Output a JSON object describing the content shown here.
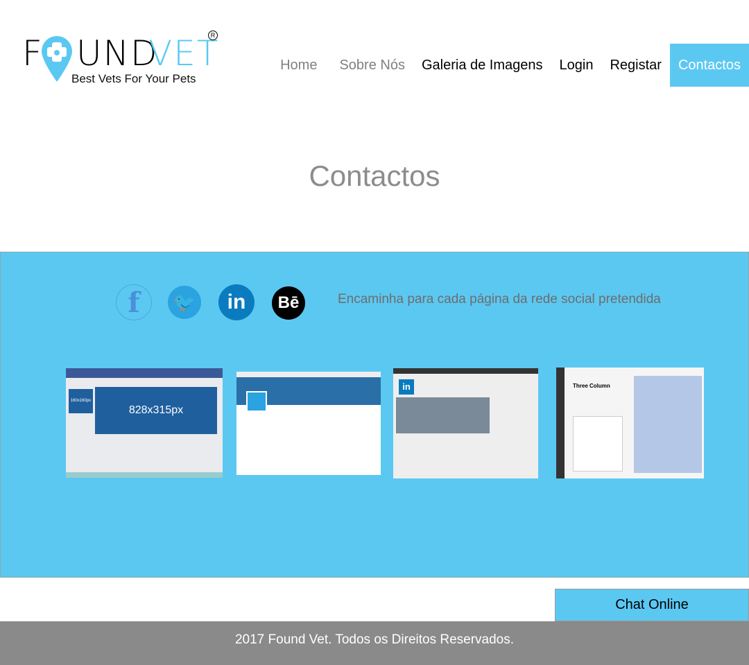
{
  "logo": {
    "found": "F",
    "und": "UND",
    "vet": "VET",
    "tagline": "Best Vets For Your Pets",
    "registered": "R"
  },
  "nav": [
    {
      "label": "Home"
    },
    {
      "label": "Sobre Nós"
    },
    {
      "label": "Galeria de Imagens"
    },
    {
      "label": "Login"
    },
    {
      "label": "Registar"
    },
    {
      "label": "Contactos"
    }
  ],
  "page_title": "Contactos",
  "social": {
    "message": "Encaminha para cada página da rede social pretendida",
    "icons": [
      "facebook-icon",
      "twitter-icon",
      "linkedin-icon",
      "behance-icon"
    ],
    "facebook_cover": "828x315px",
    "facebook_avatar": "160x160px",
    "behance_title": "Three Column"
  },
  "chat_label": "Chat Online",
  "footer": "2017 Found Vet. Todos os Direitos Reservados.",
  "colors": {
    "accent": "#5bc8f2",
    "footer": "#8a8a8a"
  }
}
